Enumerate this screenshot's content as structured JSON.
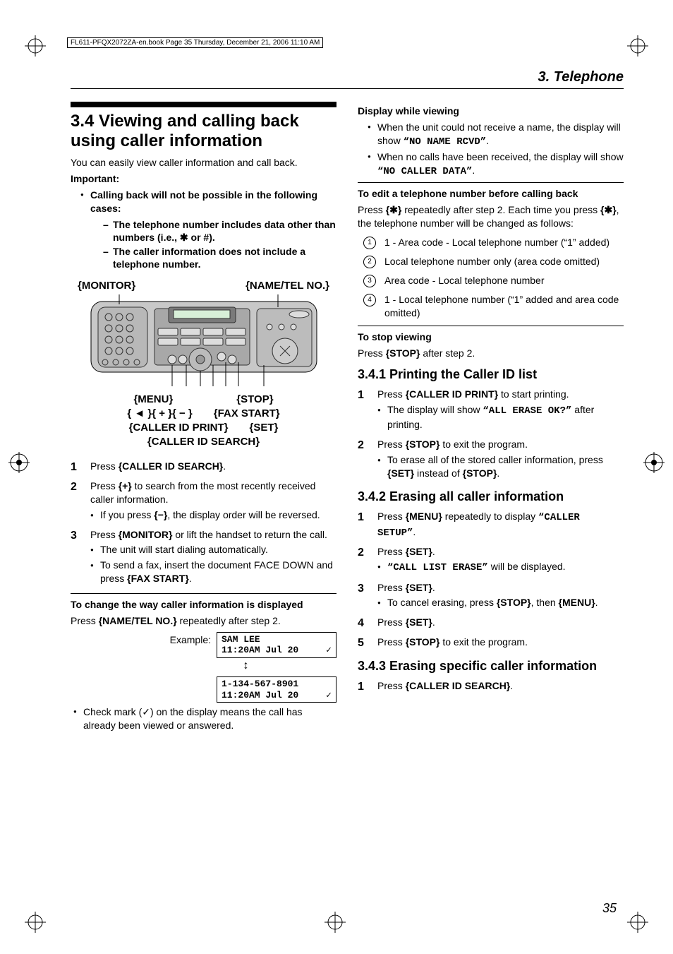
{
  "header": {
    "filebox": "FL611-PFQX2072ZA-en.book  Page 35  Thursday, December 21, 2006  11:10 AM",
    "section": "3. Telephone"
  },
  "left": {
    "title": "3.4 Viewing and calling back using caller information",
    "intro": "You can easily view caller information and call back.",
    "important_label": "Important:",
    "important_bullet": "Calling back will not be possible in the following cases:",
    "important_sub1": "The telephone number includes data other than numbers (i.e., ✱ or #).",
    "important_sub2": "The caller information does not include a telephone number.",
    "fig_label_left": "{MONITOR}",
    "fig_label_right": "{NAME/TEL NO.}",
    "fig_b_menu": "{MENU}",
    "fig_b_stop": "{STOP}",
    "fig_b_nav": "{ ◄ }{ + }{ − }",
    "fig_b_fax": "{FAX START}",
    "fig_b_cidp": "{CALLER ID PRINT}",
    "fig_b_set": "{SET}",
    "fig_b_cids": "{CALLER ID SEARCH}",
    "step1": "Press {CALLER ID SEARCH}.",
    "step2": "Press {+} to search from the most recently received caller information.",
    "step2_sub": "If you press {−}, the display order will be reversed.",
    "step3": "Press {MONITOR} or lift the handset to return the call.",
    "step3_sub1": "The unit will start dialing automatically.",
    "step3_sub2": "To send a fax, insert the document FACE DOWN and press {FAX START}.",
    "change_head": "To change the way caller information is displayed",
    "change_body_pre": "Press ",
    "change_body_key": "{NAME/TEL NO.}",
    "change_body_post": " repeatedly after step 2.",
    "example_label": "Example:",
    "lcd1_l1": "SAM LEE",
    "lcd1_l2a": "11:20AM Jul 20",
    "lcd1_l2b": "✓",
    "lcd2_l1": "1-134-567-8901",
    "lcd2_l2a": "11:20AM Jul 20",
    "lcd2_l2b": "✓",
    "check_note": "Check mark (✓) on the display means the call has already been viewed or answered."
  },
  "right": {
    "disp_head": "Display while viewing",
    "disp_b1_pre": "When the unit could not receive a name, the display will show ",
    "disp_b1_mono": "“NO NAME RCVD”",
    "disp_b1_post": ".",
    "disp_b2_pre": "When no calls have been received, the display will show ",
    "disp_b2_mono": "“NO CALLER DATA”",
    "disp_b2_post": ".",
    "edit_head": "To edit a telephone number before calling back",
    "edit_body_1": "Press ",
    "edit_body_k1": "{✱}",
    "edit_body_2": " repeatedly after step 2. Each time you press ",
    "edit_body_k2": "{✱}",
    "edit_body_3": ", the telephone number will be changed as follows:",
    "c1": "1 - Area code - Local telephone number (“1” added)",
    "c2": "Local telephone number only (area code omitted)",
    "c3": "Area code - Local telephone number",
    "c4": "1 - Local telephone number (“1” added and area code omitted)",
    "stop_head": "To stop viewing",
    "stop_body_pre": "Press ",
    "stop_body_key": "{STOP}",
    "stop_body_post": " after step 2.",
    "s341": "3.4.1 Printing the Caller ID list",
    "s341_1_pre": "Press ",
    "s341_1_key": "{CALLER ID PRINT}",
    "s341_1_post": " to start printing.",
    "s341_1_sub_pre": "The display will show ",
    "s341_1_sub_mono": "“ALL ERASE OK?”",
    "s341_1_sub_post": " after printing.",
    "s341_2_pre": "Press ",
    "s341_2_key": "{STOP}",
    "s341_2_post": " to exit the program.",
    "s341_2_sub_pre": "To erase all of the stored caller information, press ",
    "s341_2_sub_k1": "{SET}",
    "s341_2_sub_mid": " instead of ",
    "s341_2_sub_k2": "{STOP}",
    "s341_2_sub_post": ".",
    "s342": "3.4.2 Erasing all caller information",
    "s342_1_pre": "Press ",
    "s342_1_key": "{MENU}",
    "s342_1_mid": " repeatedly to display ",
    "s342_1_mono": "“CALLER SETUP”",
    "s342_1_post": ".",
    "s342_2_pre": "Press ",
    "s342_2_key": "{SET}",
    "s342_2_post": ".",
    "s342_2_sub_mono": "“CALL LIST ERASE”",
    "s342_2_sub_post": " will be displayed.",
    "s342_3_pre": "Press ",
    "s342_3_key": "{SET}",
    "s342_3_post": ".",
    "s342_3_sub_pre": "To cancel erasing, press ",
    "s342_3_sub_k1": "{STOP}",
    "s342_3_sub_mid": ", then ",
    "s342_3_sub_k2": "{MENU}",
    "s342_3_sub_post": ".",
    "s342_4_pre": "Press ",
    "s342_4_key": "{SET}",
    "s342_4_post": ".",
    "s342_5_pre": "Press ",
    "s342_5_key": "{STOP}",
    "s342_5_post": " to exit the program.",
    "s343": "3.4.3 Erasing specific caller information",
    "s343_1_pre": "Press ",
    "s343_1_key": "{CALLER ID SEARCH}",
    "s343_1_post": "."
  },
  "page_number": "35"
}
